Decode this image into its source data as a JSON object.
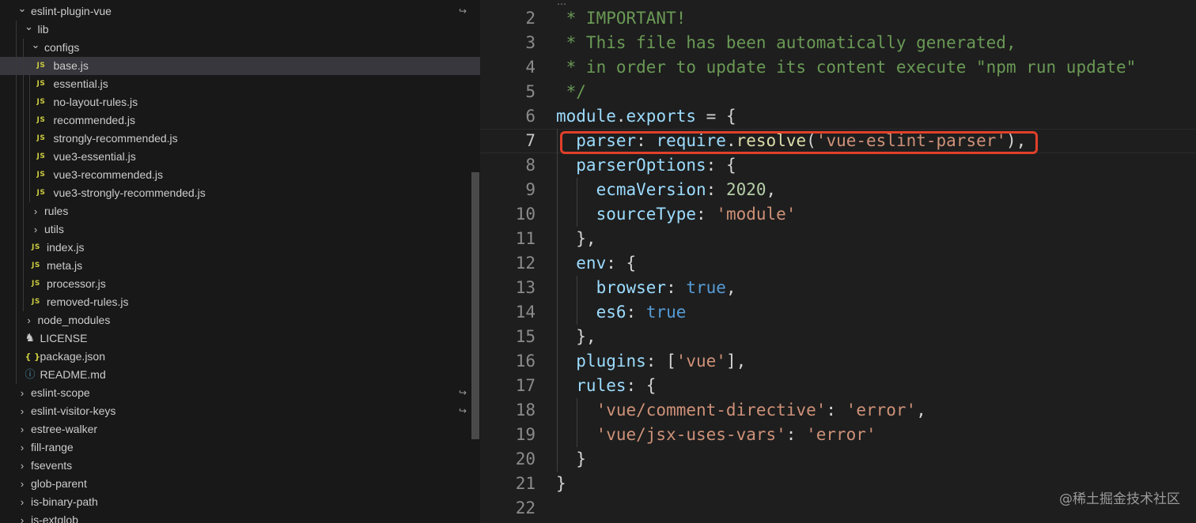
{
  "explorer": {
    "items": [
      {
        "label": "eslint-plugin-vue",
        "depth": 0,
        "kind": "folder-open",
        "linked": true
      },
      {
        "label": "lib",
        "depth": 1,
        "kind": "folder-open"
      },
      {
        "label": "configs",
        "depth": 2,
        "kind": "folder-open"
      },
      {
        "label": "base.js",
        "depth": 3,
        "kind": "js",
        "selected": true
      },
      {
        "label": "essential.js",
        "depth": 3,
        "kind": "js"
      },
      {
        "label": "no-layout-rules.js",
        "depth": 3,
        "kind": "js"
      },
      {
        "label": "recommended.js",
        "depth": 3,
        "kind": "js"
      },
      {
        "label": "strongly-recommended.js",
        "depth": 3,
        "kind": "js"
      },
      {
        "label": "vue3-essential.js",
        "depth": 3,
        "kind": "js"
      },
      {
        "label": "vue3-recommended.js",
        "depth": 3,
        "kind": "js"
      },
      {
        "label": "vue3-strongly-recommended.js",
        "depth": 3,
        "kind": "js"
      },
      {
        "label": "rules",
        "depth": 2,
        "kind": "folder-closed"
      },
      {
        "label": "utils",
        "depth": 2,
        "kind": "folder-closed"
      },
      {
        "label": "index.js",
        "depth": 2,
        "kind": "js"
      },
      {
        "label": "meta.js",
        "depth": 2,
        "kind": "js"
      },
      {
        "label": "processor.js",
        "depth": 2,
        "kind": "js"
      },
      {
        "label": "removed-rules.js",
        "depth": 2,
        "kind": "js"
      },
      {
        "label": "node_modules",
        "depth": 1,
        "kind": "folder-closed"
      },
      {
        "label": "LICENSE",
        "depth": 1,
        "kind": "license"
      },
      {
        "label": "package.json",
        "depth": 1,
        "kind": "json"
      },
      {
        "label": "README.md",
        "depth": 1,
        "kind": "info"
      },
      {
        "label": "eslint-scope",
        "depth": 0,
        "kind": "folder-closed",
        "linked": true
      },
      {
        "label": "eslint-visitor-keys",
        "depth": 0,
        "kind": "folder-closed",
        "linked": true
      },
      {
        "label": "estree-walker",
        "depth": 0,
        "kind": "folder-closed"
      },
      {
        "label": "fill-range",
        "depth": 0,
        "kind": "folder-closed"
      },
      {
        "label": "fsevents",
        "depth": 0,
        "kind": "folder-closed"
      },
      {
        "label": "glob-parent",
        "depth": 0,
        "kind": "folder-closed"
      },
      {
        "label": "is-binary-path",
        "depth": 0,
        "kind": "folder-closed"
      },
      {
        "label": "is-extglob",
        "depth": 0,
        "kind": "folder-closed"
      }
    ],
    "icons": {
      "folder-open": "chevron-down-icon",
      "folder-closed": "chevron-right-icon",
      "js": "js-file-icon",
      "json": "json-file-icon",
      "info": "info-icon",
      "license": "license-icon",
      "linked": "symlink-arrow-icon"
    },
    "icon_glyphs": {
      "js": "JS",
      "json": "{ }",
      "info": "ⓘ",
      "license": "♞",
      "open": "⌄",
      "closed": "›",
      "link": "↪"
    }
  },
  "editor": {
    "current_line": 7,
    "highlighted_line": 7,
    "lines": [
      {
        "n": "2",
        "indent": 0,
        "tokens": [
          {
            "t": " * IMPORTANT!",
            "c": "comment"
          }
        ]
      },
      {
        "n": "3",
        "indent": 0,
        "tokens": [
          {
            "t": " * This file has been automatically generated,",
            "c": "comment"
          }
        ]
      },
      {
        "n": "4",
        "indent": 0,
        "tokens": [
          {
            "t": " * in order to update its content execute \"npm run update\"",
            "c": "comment"
          }
        ]
      },
      {
        "n": "5",
        "indent": 0,
        "tokens": [
          {
            "t": " */",
            "c": "comment"
          }
        ]
      },
      {
        "n": "6",
        "indent": 0,
        "tokens": [
          {
            "t": "module",
            "c": "var"
          },
          {
            "t": ".",
            "c": "punc"
          },
          {
            "t": "exports",
            "c": "var"
          },
          {
            "t": " = {",
            "c": "punc"
          }
        ]
      },
      {
        "n": "7",
        "indent": 1,
        "tokens": [
          {
            "t": "  parser",
            "c": "prop"
          },
          {
            "t": ": ",
            "c": "punc"
          },
          {
            "t": "require",
            "c": "var"
          },
          {
            "t": ".",
            "c": "punc"
          },
          {
            "t": "resolve",
            "c": "func"
          },
          {
            "t": "(",
            "c": "punc"
          },
          {
            "t": "'vue-eslint-parser'",
            "c": "str"
          },
          {
            "t": "),",
            "c": "punc"
          }
        ]
      },
      {
        "n": "8",
        "indent": 1,
        "tokens": [
          {
            "t": "  parserOptions",
            "c": "prop"
          },
          {
            "t": ": {",
            "c": "punc"
          }
        ]
      },
      {
        "n": "9",
        "indent": 2,
        "tokens": [
          {
            "t": "    ecmaVersion",
            "c": "prop"
          },
          {
            "t": ": ",
            "c": "punc"
          },
          {
            "t": "2020",
            "c": "num"
          },
          {
            "t": ",",
            "c": "punc"
          }
        ]
      },
      {
        "n": "10",
        "indent": 2,
        "tokens": [
          {
            "t": "    sourceType",
            "c": "prop"
          },
          {
            "t": ": ",
            "c": "punc"
          },
          {
            "t": "'module'",
            "c": "str"
          }
        ]
      },
      {
        "n": "11",
        "indent": 1,
        "tokens": [
          {
            "t": "  },",
            "c": "punc"
          }
        ]
      },
      {
        "n": "12",
        "indent": 1,
        "tokens": [
          {
            "t": "  env",
            "c": "prop"
          },
          {
            "t": ": {",
            "c": "punc"
          }
        ]
      },
      {
        "n": "13",
        "indent": 2,
        "tokens": [
          {
            "t": "    browser",
            "c": "prop"
          },
          {
            "t": ": ",
            "c": "punc"
          },
          {
            "t": "true",
            "c": "kw"
          },
          {
            "t": ",",
            "c": "punc"
          }
        ]
      },
      {
        "n": "14",
        "indent": 2,
        "tokens": [
          {
            "t": "    es6",
            "c": "prop"
          },
          {
            "t": ": ",
            "c": "punc"
          },
          {
            "t": "true",
            "c": "kw"
          }
        ]
      },
      {
        "n": "15",
        "indent": 1,
        "tokens": [
          {
            "t": "  },",
            "c": "punc"
          }
        ]
      },
      {
        "n": "16",
        "indent": 1,
        "tokens": [
          {
            "t": "  plugins",
            "c": "prop"
          },
          {
            "t": ": [",
            "c": "punc"
          },
          {
            "t": "'vue'",
            "c": "str"
          },
          {
            "t": "],",
            "c": "punc"
          }
        ]
      },
      {
        "n": "17",
        "indent": 1,
        "tokens": [
          {
            "t": "  rules",
            "c": "prop"
          },
          {
            "t": ": {",
            "c": "punc"
          }
        ]
      },
      {
        "n": "18",
        "indent": 2,
        "tokens": [
          {
            "t": "    'vue/comment-directive'",
            "c": "str"
          },
          {
            "t": ": ",
            "c": "punc"
          },
          {
            "t": "'error'",
            "c": "str"
          },
          {
            "t": ",",
            "c": "punc"
          }
        ]
      },
      {
        "n": "19",
        "indent": 2,
        "tokens": [
          {
            "t": "    'vue/jsx-uses-vars'",
            "c": "str"
          },
          {
            "t": ": ",
            "c": "punc"
          },
          {
            "t": "'error'",
            "c": "str"
          }
        ]
      },
      {
        "n": "20",
        "indent": 1,
        "tokens": [
          {
            "t": "  }",
            "c": "punc"
          }
        ]
      },
      {
        "n": "21",
        "indent": 0,
        "tokens": [
          {
            "t": "}",
            "c": "punc"
          }
        ]
      },
      {
        "n": "22",
        "indent": 0,
        "tokens": []
      }
    ],
    "fold_marker": "⋯"
  },
  "watermark": "@稀土掘金技术社区",
  "colors": {
    "highlight_border": "#e0402a",
    "comment": "#6a9955",
    "string": "#ce9178",
    "keyword": "#569cd6",
    "number": "#b5cea8",
    "function": "#dcdcaa",
    "variable": "#9cdcfe"
  }
}
